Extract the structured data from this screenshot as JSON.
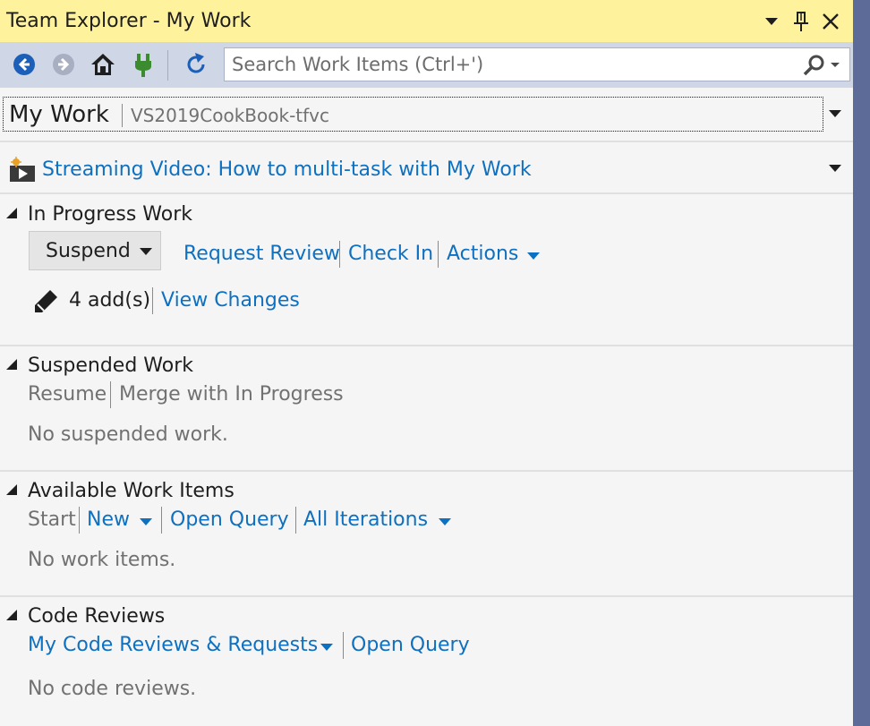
{
  "window": {
    "title": "Team Explorer - My Work",
    "dropdown_icon": "chevron-down-icon",
    "pin_icon": "pin-icon",
    "close_icon": "close-icon"
  },
  "toolbar": {
    "buttons": [
      "back-icon",
      "forward-icon",
      "home-icon",
      "connect-icon",
      "refresh-icon"
    ],
    "search_placeholder": "Search Work Items (Ctrl+')"
  },
  "header": {
    "page_title": "My Work",
    "project": "VS2019CookBook-tfvc"
  },
  "video_link": "Streaming Video: How to multi-task with My Work",
  "in_progress": {
    "title": "In Progress Work",
    "suspend_label": "Suspend",
    "actions": [
      "Request Review",
      "Check In",
      "Actions"
    ],
    "changes_count": "4 add(s)",
    "view_changes": "View Changes"
  },
  "suspended": {
    "title": "Suspended Work",
    "actions": [
      "Resume",
      "Merge with In Progress"
    ],
    "empty": "No suspended work."
  },
  "available": {
    "title": "Available Work Items",
    "actions": [
      "Start",
      "New",
      "Open Query",
      "All Iterations"
    ],
    "empty": "No work items."
  },
  "code_reviews": {
    "title": "Code Reviews",
    "actions": [
      "My Code Reviews & Requests",
      "Open Query"
    ],
    "empty": "No code reviews."
  },
  "colors": {
    "title_bar": "#fff29d",
    "toolbar": "#cfd6e5",
    "link": "#0e70c0",
    "frame": "#5d6b99",
    "panel": "#f5f5f5"
  }
}
